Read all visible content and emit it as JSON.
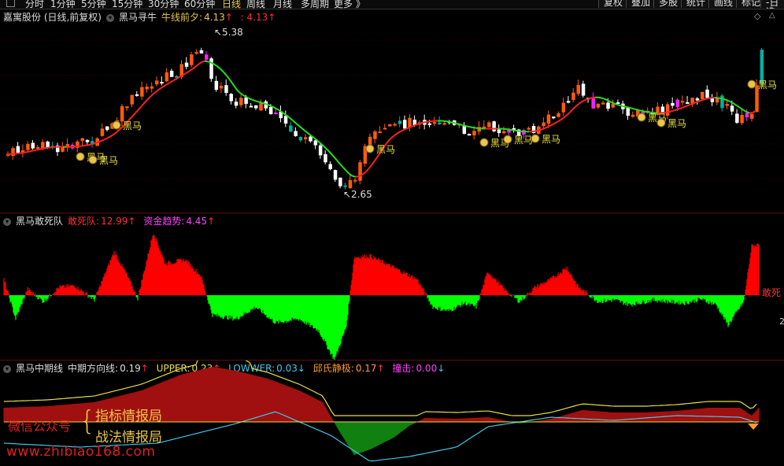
{
  "toolbar": {
    "left_items": [
      "分时",
      "1分钟",
      "5分钟",
      "15分钟",
      "30分钟",
      "60分钟",
      "日线",
      "周线",
      "月线",
      "多周期",
      "更多 》"
    ],
    "active_item": "日线",
    "right_buttons": [
      "复权",
      "叠加",
      "多股",
      "统计",
      "画线",
      "标记",
      "-日选"
    ]
  },
  "main_panel": {
    "stock": "嘉寓股份 (日线,前复权)",
    "indicator": "黑马寻牛",
    "param_label": "牛线前夕:",
    "param_value1": "4.13",
    "param_value2": ": 4.13",
    "high_label": "5.38",
    "low_label": "2.65",
    "signal_text": "黑马",
    "signal_icon": "money-bag-icon"
  },
  "panel2": {
    "title": "黑马敢死队",
    "label1": "敢死队:",
    "value1": "12.99",
    "label2": "资金趋势:",
    "value2": "4.45",
    "right_label": "敢死",
    "right_num": "2"
  },
  "panel3": {
    "title": "黑马中期线",
    "l1": "中期方向线:",
    "v1": "0.19",
    "l2": "UPPER:",
    "v2": "0.23",
    "l3": "LOWWER:",
    "v3": "0.03",
    "l4": "邱氏静极:",
    "v4": "0.17",
    "l5": "撞击:",
    "v5": "0.00"
  },
  "watermark": {
    "public_label": "微信公众号",
    "line1": "指标情报局",
    "line2": "战法情报局",
    "url": "www.zhibiao168.com"
  },
  "colors": {
    "up": "#ff4a1a",
    "down": "#ffffff",
    "red_bar": "#ff0000",
    "green_bar": "#00ff00",
    "curve_green": "#00e000",
    "curve_red": "#ff2020",
    "upper": "#e8e040",
    "lower": "#40c8e8"
  }
}
